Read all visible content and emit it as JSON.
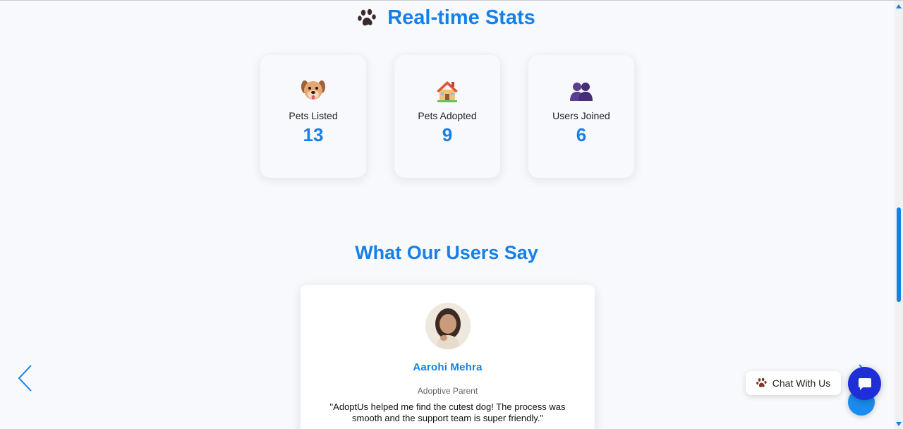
{
  "stats": {
    "title": "Real-time Stats",
    "cards": [
      {
        "icon": "dog-face-icon",
        "label": "Pets Listed",
        "value": "13"
      },
      {
        "icon": "house-icon",
        "label": "Pets Adopted",
        "value": "9"
      },
      {
        "icon": "users-icon",
        "label": "Users Joined",
        "value": "6"
      }
    ]
  },
  "testimonials": {
    "title": "What Our Users Say",
    "current": {
      "name": "Aarohi Mehra",
      "role": "Adoptive Parent",
      "quote": "\"AdoptUs helped me find the cutest dog! The process was smooth and the support team is super friendly.\""
    }
  },
  "chat": {
    "label": "Chat With Us"
  },
  "colors": {
    "accent": "#1580e8",
    "chat_fab": "#1f2fd8",
    "background": "#f7f9fc"
  }
}
